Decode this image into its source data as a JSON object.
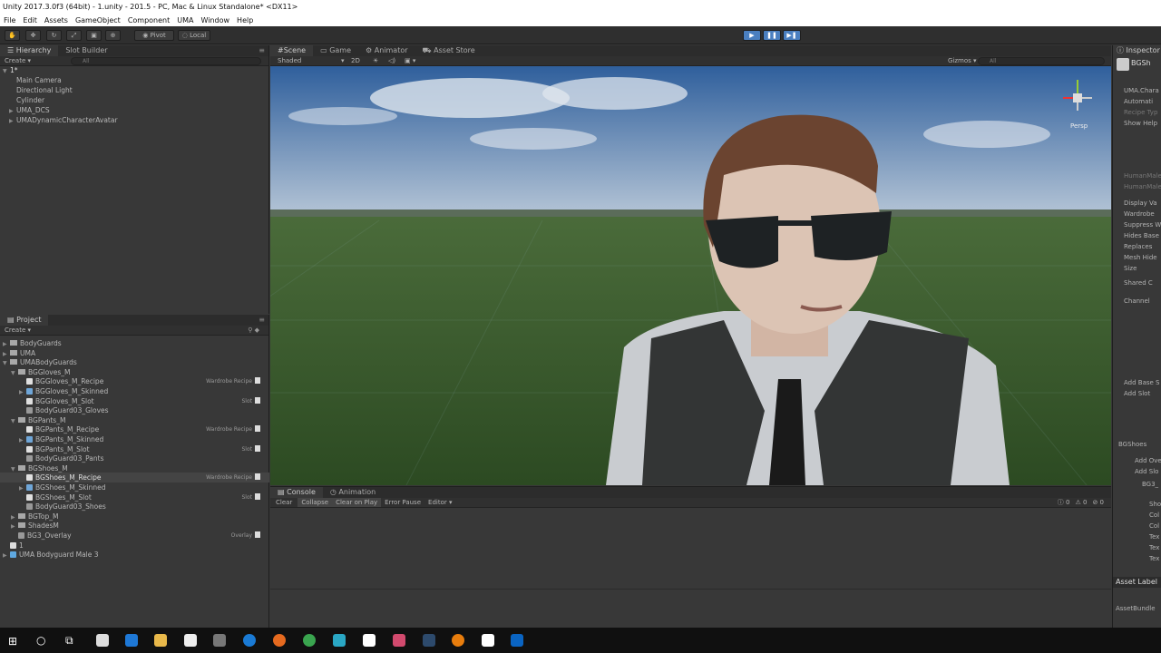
{
  "window": {
    "title": "Unity 2017.3.0f3 (64bit) - 1.unity - 201.5 - PC, Mac & Linux Standalone* <DX11>"
  },
  "menu": [
    "File",
    "Edit",
    "Assets",
    "GameObject",
    "Component",
    "UMA",
    "Window",
    "Help"
  ],
  "toolbar": {
    "pivot": "Pivot",
    "local": "Local"
  },
  "hierarchy": {
    "tabs": [
      "Hierarchy",
      "Slot Builder"
    ],
    "create": "Create",
    "search": "All",
    "scene": "1*",
    "items": [
      "Main Camera",
      "Directional Light",
      "Cylinder",
      "UMA_DCS",
      "UMADynamicCharacterAvatar"
    ]
  },
  "project": {
    "tab": "Project",
    "create": "Create",
    "items": [
      {
        "label": "BodyGuards",
        "kind": "folder",
        "indent": 0,
        "arrow": "▶",
        "right": ""
      },
      {
        "label": "UMA",
        "kind": "folder",
        "indent": 0,
        "arrow": "▶",
        "right": ""
      },
      {
        "label": "UMABodyGuards",
        "kind": "folder",
        "indent": 0,
        "arrow": "▼",
        "right": ""
      },
      {
        "label": "BGGloves_M",
        "kind": "folder",
        "indent": 1,
        "arrow": "▼",
        "right": ""
      },
      {
        "label": "BGGloves_M_Recipe",
        "kind": "recipe",
        "indent": 2,
        "arrow": "",
        "right": "Wardrobe Recipe"
      },
      {
        "label": "BGGloves_M_Skinned",
        "kind": "mesh",
        "indent": 2,
        "arrow": "▶",
        "right": ""
      },
      {
        "label": "BGGloves_M_Slot",
        "kind": "slot",
        "indent": 2,
        "arrow": "",
        "right": "Slot"
      },
      {
        "label": "BodyGuard03_Gloves",
        "kind": "overlay",
        "indent": 2,
        "arrow": "",
        "right": ""
      },
      {
        "label": "BGPants_M",
        "kind": "folder",
        "indent": 1,
        "arrow": "▼",
        "right": ""
      },
      {
        "label": "BGPants_M_Recipe",
        "kind": "recipe",
        "indent": 2,
        "arrow": "",
        "right": "Wardrobe Recipe"
      },
      {
        "label": "BGPants_M_Skinned",
        "kind": "mesh",
        "indent": 2,
        "arrow": "▶",
        "right": ""
      },
      {
        "label": "BGPants_M_Slot",
        "kind": "slot",
        "indent": 2,
        "arrow": "",
        "right": "Slot"
      },
      {
        "label": "BodyGuard03_Pants",
        "kind": "overlay",
        "indent": 2,
        "arrow": "",
        "right": ""
      },
      {
        "label": "BGShoes_M",
        "kind": "folder",
        "indent": 1,
        "arrow": "▼",
        "right": ""
      },
      {
        "label": "BGShoes_M_Recipe",
        "kind": "recipe",
        "indent": 2,
        "arrow": "",
        "right": "Wardrobe Recipe",
        "selected": true
      },
      {
        "label": "BGShoes_M_Skinned",
        "kind": "mesh",
        "indent": 2,
        "arrow": "▶",
        "right": ""
      },
      {
        "label": "BGShoes_M_Slot",
        "kind": "slot",
        "indent": 2,
        "arrow": "",
        "right": "Slot"
      },
      {
        "label": "BodyGuard03_Shoes",
        "kind": "overlay",
        "indent": 2,
        "arrow": "",
        "right": ""
      },
      {
        "label": "BGTop_M",
        "kind": "folder",
        "indent": 1,
        "arrow": "▶",
        "right": ""
      },
      {
        "label": "ShadesM",
        "kind": "folder",
        "indent": 1,
        "arrow": "▶",
        "right": ""
      },
      {
        "label": "BG3_Overlay",
        "kind": "overlay",
        "indent": 1,
        "arrow": "",
        "right": "Overlay"
      },
      {
        "label": "1",
        "kind": "scene",
        "indent": 0,
        "arrow": "",
        "right": ""
      },
      {
        "label": "UMA Bodyguard Male 3",
        "kind": "prefab",
        "indent": 0,
        "arrow": "▶",
        "right": ""
      }
    ]
  },
  "scene": {
    "tabs": [
      "Scene",
      "Game",
      "Animator",
      "Asset Store"
    ],
    "shading": "Shaded",
    "mode2d": "2D",
    "gizmos": "Gizmos",
    "search": "All",
    "persp": "Persp"
  },
  "console": {
    "tabs": [
      "Console",
      "Animation"
    ],
    "buttons": [
      "Clear",
      "Collapse",
      "Clear on Play",
      "Error Pause",
      "Editor"
    ],
    "counts": [
      "0",
      "0",
      "0"
    ]
  },
  "inspector": {
    "tab": "Inspector",
    "object": "BGSh",
    "lines": [
      "UMA.Chara",
      "Automati",
      "Recipe Typ",
      "Show Help",
      "HumanMale",
      "HumanMale",
      "Display Va",
      "Wardrobe",
      "Suppress W",
      "Hides Base",
      "Replaces",
      "Mesh Hide",
      "Size",
      "Shared C",
      "Channel",
      "Add Base S",
      "Add Slot",
      "BGShoes",
      "Add Ove",
      "Add Slo",
      "BG3_",
      "Sho",
      "Col",
      "Col",
      "Tex",
      "Tex",
      "Tex"
    ],
    "asset_labels": "Asset Label",
    "asset_bundle": "AssetBundle"
  }
}
